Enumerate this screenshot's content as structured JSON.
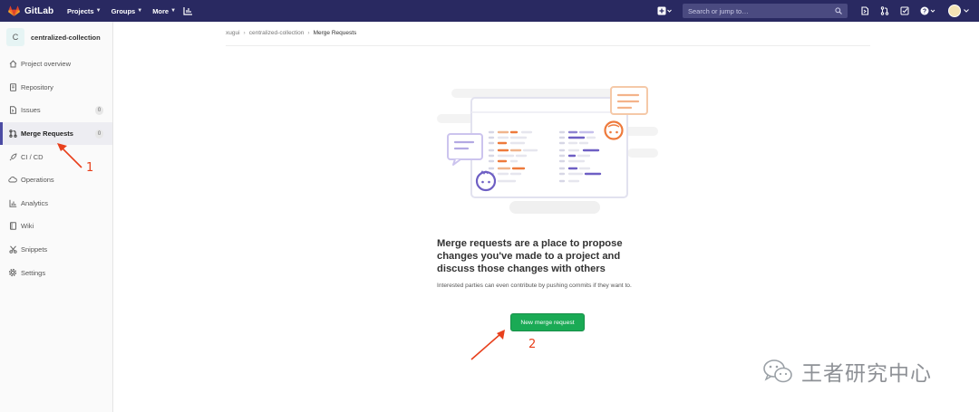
{
  "topbar": {
    "brand": "GitLab",
    "nav": [
      {
        "label": "Projects"
      },
      {
        "label": "Groups"
      },
      {
        "label": "More"
      }
    ],
    "search_placeholder": "Search or jump to…"
  },
  "sidebar": {
    "project_letter": "C",
    "project_name": "centralized-collection",
    "items": [
      {
        "label": "Project overview",
        "icon": "home-icon"
      },
      {
        "label": "Repository",
        "icon": "doc-icon"
      },
      {
        "label": "Issues",
        "icon": "issues-icon",
        "badge": "0"
      },
      {
        "label": "Merge Requests",
        "icon": "merge-request-icon",
        "badge": "0",
        "active": true
      },
      {
        "label": "CI / CD",
        "icon": "rocket-icon"
      },
      {
        "label": "Operations",
        "icon": "cloud-icon"
      },
      {
        "label": "Analytics",
        "icon": "chart-icon"
      },
      {
        "label": "Wiki",
        "icon": "book-icon"
      },
      {
        "label": "Snippets",
        "icon": "scissors-icon"
      },
      {
        "label": "Settings",
        "icon": "gear-icon"
      }
    ]
  },
  "breadcrumb": {
    "items": [
      "xugui",
      "centralized-collection",
      "Merge Requests"
    ]
  },
  "empty_state": {
    "title": "Merge requests are a place to propose changes you've made to a project and discuss those changes with others",
    "text": "Interested parties can even contribute by pushing commits if they want to.",
    "button": "New merge request"
  },
  "annotations": {
    "step1": "1",
    "step2": "2",
    "watermark": "王者研究中心",
    "accent": "#e8401c"
  },
  "colors": {
    "topbar": "#292961",
    "active_item": "#4b4ba3",
    "button": "#1aaa55"
  }
}
